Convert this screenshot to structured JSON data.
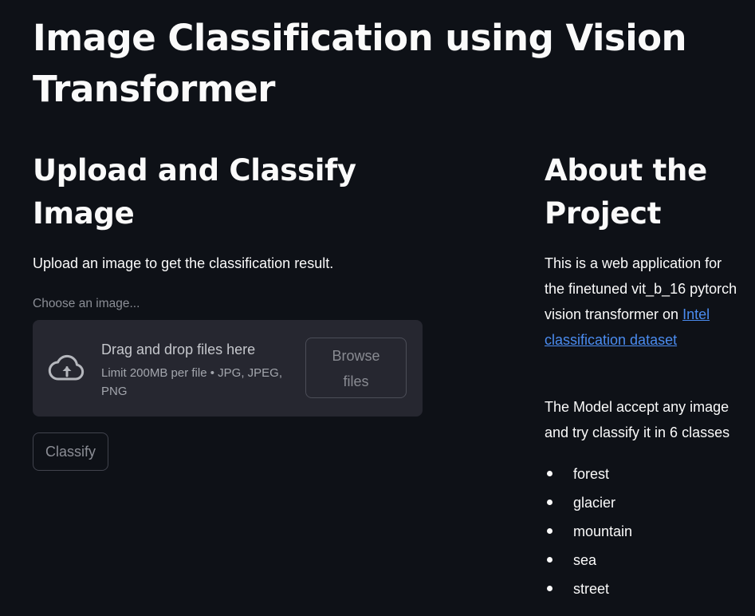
{
  "page": {
    "title": "Image Classification using Vision Transformer"
  },
  "upload_section": {
    "title": "Upload and Classify Image",
    "description": "Upload an image to get the classification result.",
    "uploader": {
      "label": "Choose an image...",
      "drop_text": "Drag and drop files here",
      "limit_text": "Limit 200MB per file • JPG, JPEG, PNG",
      "browse_label": "Browse files",
      "icon": "cloud-upload-icon"
    },
    "classify_label": "Classify"
  },
  "about_section": {
    "title": "About the Project",
    "desc_text": "This is a web application for the finetuned vit_b_16 pytorch vision transformer on ",
    "link_text": "Intel classification dataset",
    "model_text": "The Model accept any image and try classify it in 6 classes",
    "classes": [
      "forest",
      "glacier",
      "mountain",
      "sea",
      "street"
    ]
  },
  "colors": {
    "background": "#0e1117",
    "text": "#fafafa",
    "dropzone": "#262730",
    "link": "#4b8cf0",
    "muted": "#8b8e96"
  }
}
